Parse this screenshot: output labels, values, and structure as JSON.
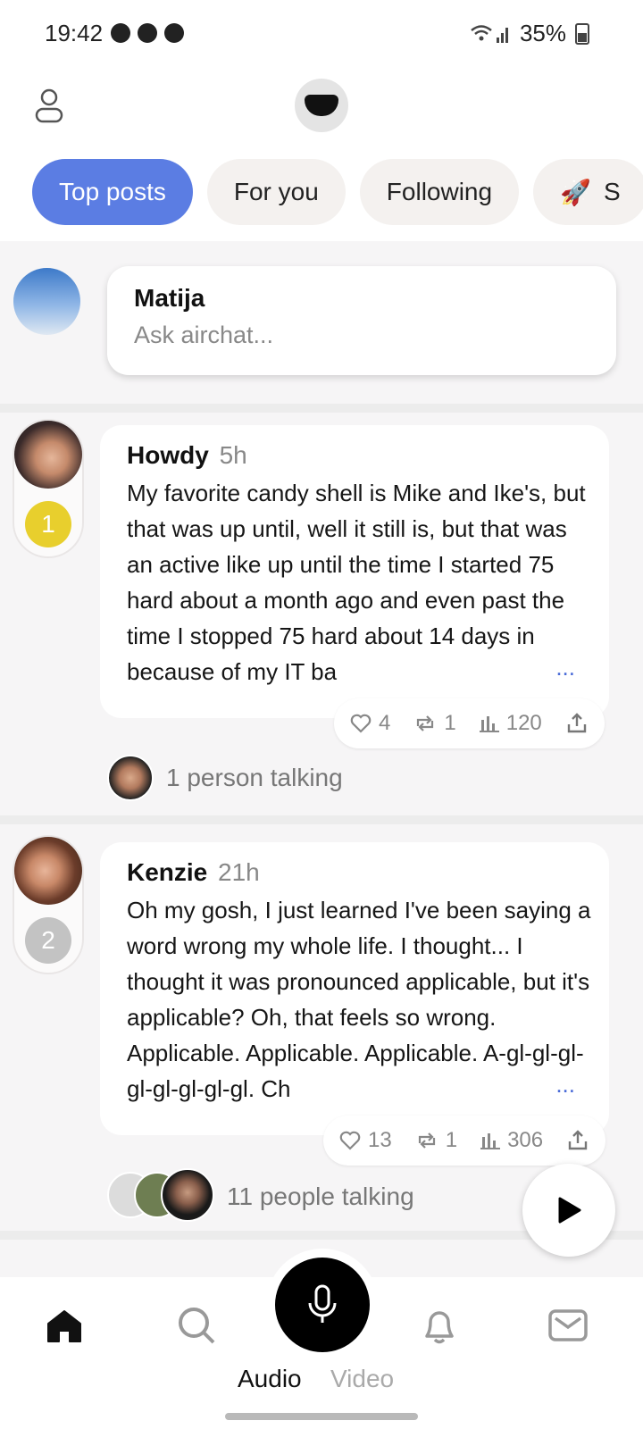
{
  "status_bar": {
    "time": "19:42",
    "battery": "35%"
  },
  "tabs": [
    {
      "label": "Top posts",
      "active": true
    },
    {
      "label": "For you",
      "active": false
    },
    {
      "label": "Following",
      "active": false
    },
    {
      "label": "S",
      "active": false,
      "icon": "rocket-icon"
    }
  ],
  "composer": {
    "name": "Matija",
    "placeholder": "Ask airchat..."
  },
  "posts": [
    {
      "author": "Howdy",
      "age": "5h",
      "rank": "1",
      "rank_color": "#e8cf2d",
      "text": "My favorite candy shell is Mike and Ike's, but that was up until, well it still is, but that was an active like up until the time I started 75 hard about a month ago and even past the time I stopped 75 hard about 14 days in because of my IT ba",
      "likes": "4",
      "reposts": "1",
      "views": "120",
      "talking": "1 person talking"
    },
    {
      "author": "Kenzie",
      "age": "21h",
      "rank": "2",
      "rank_color": "#c3c3c3",
      "text": "Oh my gosh, I just learned I've been saying a word wrong my whole life. I thought... I thought it was pronounced applicable, but it's applicable? Oh, that feels so wrong. Applicable. Applicable. Applicable. A-gl-gl-gl-gl-gl-gl-gl-gl. Ch",
      "likes": "13",
      "reposts": "1",
      "views": "306",
      "talking": "11 people talking"
    }
  ],
  "more_label": "...",
  "nav": {
    "audio_label": "Audio",
    "video_label": "Video"
  }
}
